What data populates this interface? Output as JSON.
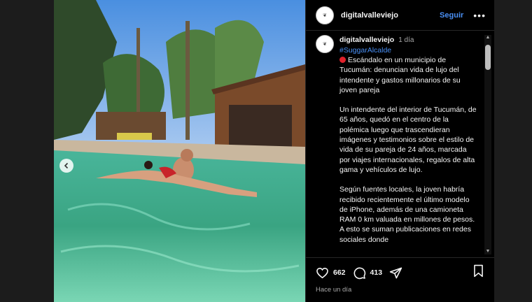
{
  "header": {
    "username": "digitalvalleviejo",
    "follow_label": "Seguir",
    "more_label": "•••"
  },
  "caption": {
    "username": "digitalvalleviejo",
    "time": "1 día",
    "hashtag": "#SuggarAlcalde",
    "headline": "Escándalo en un municipio de Tucumán: denuncian vida de lujo del intendente y gastos millonarios de su joven pareja",
    "paragraph_1": "Un intendente del interior de Tucumán, de 65 años, quedó en el centro de la polémica luego que trascendieran imágenes y testimonios sobre el estilo de vida de su pareja de 24 años, marcada por viajes internacionales, regalos de alta gama y vehículos de lujo.",
    "paragraph_2": "Según fuentes locales, la joven habría recibido recientemente el último modelo de iPhone, además de una camioneta RAM 0 km valuada en millones de pesos. A esto se suman publicaciones en redes sociales donde"
  },
  "actions": {
    "likes": "662",
    "comments": "413",
    "time_ago": "Hace un día"
  },
  "icons": {
    "like": "heart-icon",
    "comment": "comment-icon",
    "share": "send-icon",
    "save": "bookmark-icon",
    "prev": "chevron-left-icon",
    "more": "more-dots-icon",
    "headline_marker": "red-circle-icon"
  },
  "colors": {
    "accent": "#4a90f5",
    "background": "#000000",
    "marker": "#e0212b"
  }
}
